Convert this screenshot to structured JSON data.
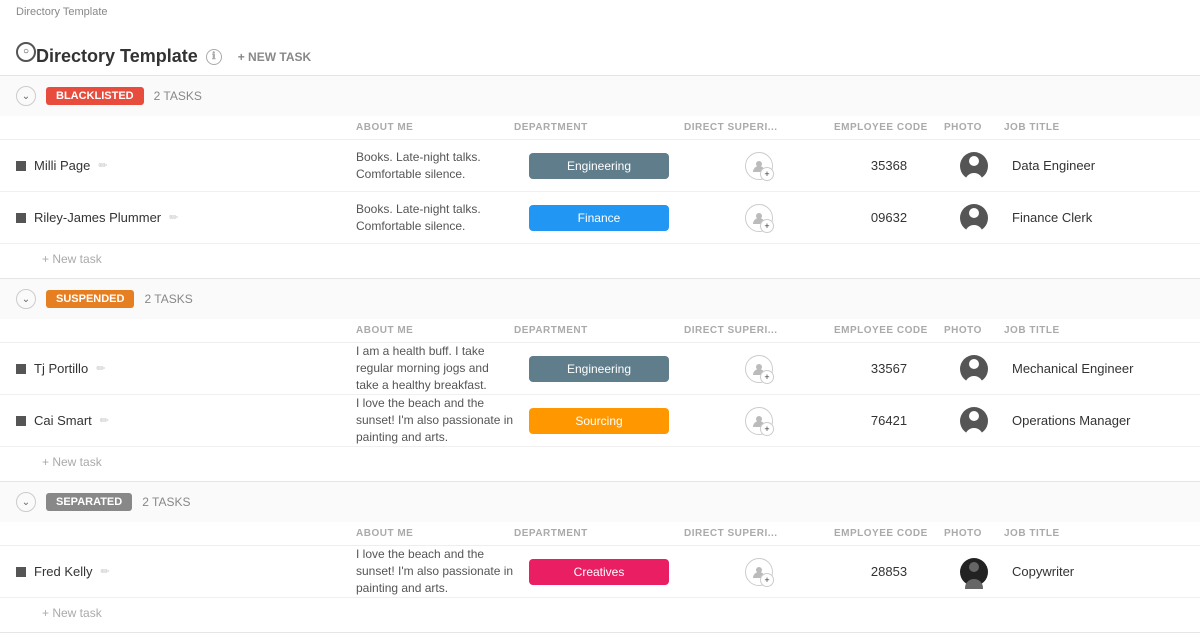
{
  "breadcrumb": "Directory Template",
  "title": "Directory Template",
  "new_task_label": "+ NEW TASK",
  "info_icon": "ℹ",
  "columns": {
    "about": "ABOUT ME",
    "department": "DEPARTMENT",
    "supervisor": "DIRECT SUPERI...",
    "employee_code": "EMPLOYEE CODE",
    "photo": "PHOTO",
    "job_title": "JOB TITLE"
  },
  "sections": [
    {
      "id": "blacklisted",
      "badge_label": "BLACKLISTED",
      "badge_class": "badge-blacklisted",
      "badge_icon": "■",
      "task_count": "2 TASKS",
      "rows": [
        {
          "name": "Milli Page",
          "about": "Books. Late-night talks. Comfortable silence.",
          "department": "Engineering",
          "dept_class": "dept-engineering",
          "dept_icon": "✏",
          "supervisor_code": "",
          "employee_code": "35368",
          "job_title": "Data Engineer"
        },
        {
          "name": "Riley-James Plummer",
          "about": "Books. Late-night talks. Comfortable silence.",
          "department": "Finance",
          "dept_class": "dept-finance",
          "dept_icon": "💵",
          "supervisor_code": "",
          "employee_code": "09632",
          "job_title": "Finance Clerk"
        }
      ],
      "new_task": "+ New task"
    },
    {
      "id": "suspended",
      "badge_label": "SUSPENDED",
      "badge_class": "badge-suspended",
      "badge_icon": "⏸",
      "task_count": "2 TASKS",
      "rows": [
        {
          "name": "Tj Portillo",
          "about": "I am a health buff. I take regular morning jogs and take a healthy breakfast.",
          "department": "Engineering",
          "dept_class": "dept-engineering",
          "dept_icon": "✏",
          "supervisor_code": "",
          "employee_code": "33567",
          "job_title": "Mechanical Engineer"
        },
        {
          "name": "Cai Smart",
          "about": "I love the beach and the sunset! I'm also passionate in painting and arts.",
          "department": "Sourcing",
          "dept_class": "dept-sourcing",
          "dept_icon": "📍",
          "supervisor_code": "",
          "employee_code": "76421",
          "job_title": "Operations Manager"
        }
      ],
      "new_task": "+ New task"
    },
    {
      "id": "separated",
      "badge_label": "SEPARATED",
      "badge_class": "badge-separated",
      "badge_icon": "✕",
      "task_count": "2 TASKS",
      "rows": [
        {
          "name": "Fred Kelly",
          "about": "I love the beach and the sunset! I'm also passionate in painting and arts.",
          "department": "Creatives",
          "dept_class": "dept-creatives",
          "dept_icon": "🎨",
          "supervisor_code": "",
          "employee_code": "28853",
          "job_title": "Copywriter"
        }
      ],
      "new_task": "+ New task"
    }
  ]
}
